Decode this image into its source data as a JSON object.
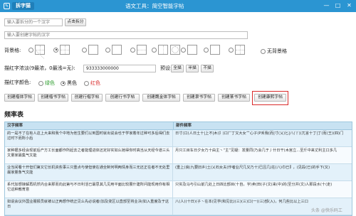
{
  "window": {
    "app_name": "拆字猫",
    "title": "语文工具：简空智能字帖",
    "minimize": "—",
    "maximize": "□",
    "close": "✕"
  },
  "search": {
    "placeholder": "输入要拆分的一个汉字",
    "button": "点击拆分"
  },
  "copybook_input": {
    "placeholder": "输入要创建字帖的汉字"
  },
  "background": {
    "label": "背景格:",
    "options": [
      {
        "style": "cross-diag",
        "selected": false
      },
      {
        "style": "cross",
        "selected": true
      },
      {
        "style": "plain",
        "selected": false
      },
      {
        "style": "plain",
        "selected": false
      },
      {
        "style": "h-line",
        "selected": false
      },
      {
        "style": "v-line",
        "selected": false
      },
      {
        "style": "circle",
        "selected": false
      },
      {
        "style": "plain",
        "selected": false
      },
      {
        "style": "plain",
        "selected": false
      },
      {
        "style": "cross",
        "selected": false
      }
    ],
    "none_label": "无背景格"
  },
  "stroke": {
    "label": "描红字浓淡(9最浓，0最浅=无):",
    "value": "933333000000",
    "preset_label": "预设:",
    "presets": [
      "全描",
      "半描",
      "不描"
    ]
  },
  "color": {
    "label": "描红字颜色:",
    "options": [
      {
        "label": "绿色",
        "color": "#2e9e2e",
        "selected": false
      },
      {
        "label": "黑色",
        "color": "#222222",
        "selected": true
      },
      {
        "label": "红色",
        "color": "#d92a2a",
        "selected": false
      }
    ]
  },
  "actions": [
    "创建楷体字帖",
    "创建楷书字帖",
    "创建行楷字帖",
    "创建行书字帖",
    "创建魏金体字帖",
    "创建隶书字帖",
    "创建篆书字帖",
    "创建康熙字帖"
  ],
  "frequency": {
    "title": "频率表",
    "headers": [
      "汉字频率",
      "部件频率"
    ],
    "rows": [
      [
        "的一是不了在有人这上大来和我个中地为他生要们以到国时就出说会也于学家着年过种可多后得们去过时下而所小后",
        "日寸(口(人日土十|上不|木(扌)口厂丁又大女亠心子(P禾我(而|寸(乂)匕|八(丫)(兀言十丁|丁(而(王)(四)门"
      ],
      [
        "家种据多经会现前后产方工长面都作所起去之者能理进体还定好实如么她得你时高当从天经今道三头文量家最集气文能",
        "月只工目车日夕女乃十由主丶“主”见疑：发量同(乃会几于丿什日干(木宫立...至斤中来丈利主口多几"
      ],
      [
        "业当间看十开但们第又它长机资些事三只重点与使但使在通全制何明两情身而三无还正在者不无处里最家量象气文能",
        "(重上(良(九要旧乡)土(乂石女夫(作者业尺几又乃十)巳吕几)在(八)巾已阝，(见段(已)的手下(又)"
      ],
      [
        "系代加想接解再机然内合来那而向此第与不日利活已最思其几见用平面比较展什建所问能现用你有相它这种教育意",
        "只实及马与引山前几处上日四比部目(十自，字)卖(田(子(文(来(中)的(至分并(文)人那段水(十(走)"
      ],
      [
        "如说会议外国业服报员就被以正两想作统正见么先必说者(加及变区以直部至将业决(如入重度及于这日",
        "八(人)(十日)(子丶在本(见学(和见比)(三)(三)口(一)(三)部(入)，何几些比以上三口"
      ]
    ]
  },
  "watermark": "头条 @快乐码工"
}
